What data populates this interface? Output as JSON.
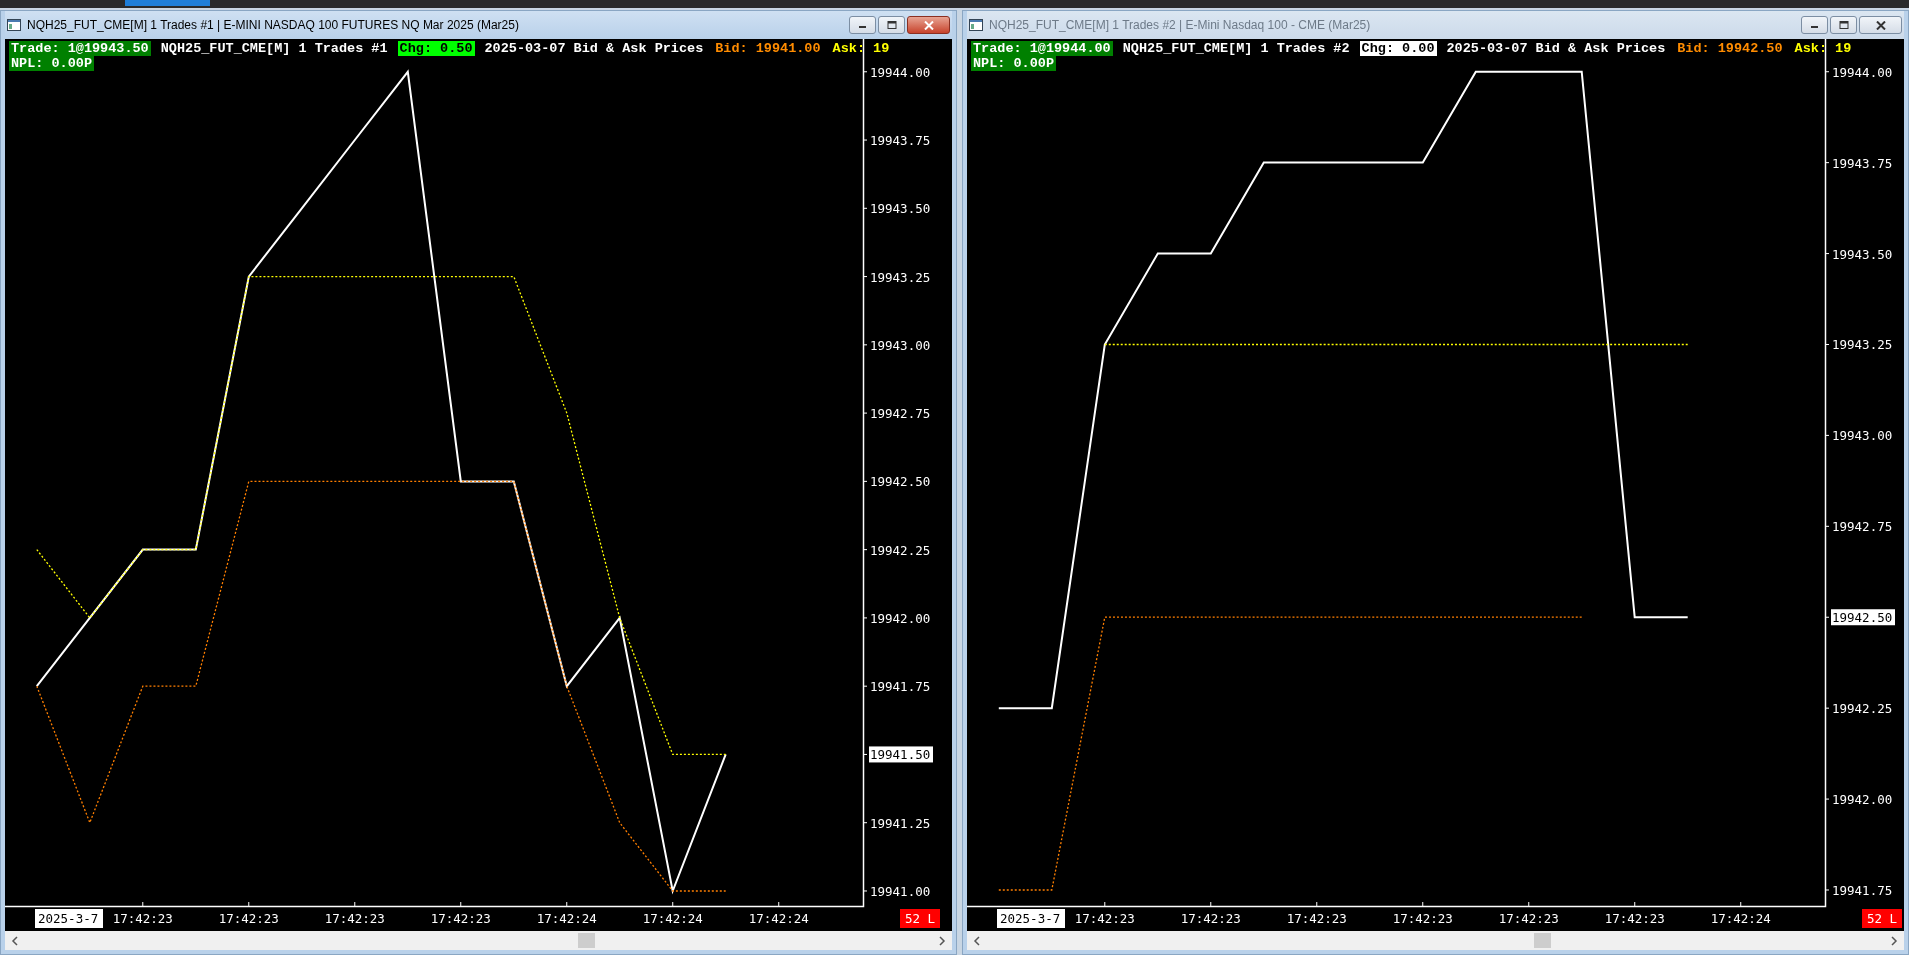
{
  "windows": [
    {
      "title": "NQH25_FUT_CME[M]  1 Trades #1 | E-MINI NASDAQ 100 FUTURES NQ Mar 2025 (Mar25)",
      "active": true,
      "header": {
        "trade": "Trade: 1@19943.50",
        "symbol": "NQH25_FUT_CME[M]  1 Trades #1",
        "chg": {
          "text": "Chg: 0.50",
          "color": "#00ff00"
        },
        "caption": "2025-03-07 Bid & Ask Prices",
        "bid": "Bid: 19941.00",
        "ask": "Ask: 19",
        "npl": "NPL: 0.00P"
      },
      "chart_data": {
        "type": "line",
        "categories": [
          null,
          null,
          "17:42:23",
          null,
          "17:42:23",
          null,
          "17:42:23",
          null,
          "17:42:23",
          null,
          "17:42:24",
          null,
          "17:42:24",
          null,
          "17:42:24"
        ],
        "ylim": [
          19940.945,
          19944.12
        ],
        "series": [
          {
            "color": "#ffff00",
            "line_style": "dashed",
            "values": [
              19942.25,
              19942.0,
              19942.25,
              19942.25,
              19943.25,
              19943.25,
              19943.25,
              19943.25,
              19943.25,
              19943.25,
              19942.75,
              19942.0,
              19941.5,
              19941.5,
              null
            ]
          },
          {
            "color": "#ff7f00",
            "line_style": "dashed",
            "values": [
              19941.75,
              19941.25,
              19941.75,
              19941.75,
              19942.5,
              19942.5,
              19942.5,
              19942.5,
              19942.5,
              19942.5,
              19941.75,
              19941.25,
              19941.0,
              19941.0,
              null
            ]
          },
          {
            "color": "#ffffff",
            "line_style": "solid",
            "values": [
              19941.75,
              19942.0,
              19942.25,
              19942.25,
              19943.25,
              19943.5,
              19943.75,
              19944.0,
              19942.5,
              19942.5,
              19941.75,
              19942.0,
              19941.0,
              19941.5,
              null
            ]
          }
        ],
        "yticks": [
          {
            "value": 19941.0,
            "label": "19941.00"
          },
          {
            "value": 19941.25,
            "label": "19941.25"
          },
          {
            "value": 19941.5,
            "label": "19941.50"
          },
          {
            "value": 19941.75,
            "label": "19941.75"
          },
          {
            "value": 19942.0,
            "label": "19942.00"
          },
          {
            "value": 19942.25,
            "label": "19942.25"
          },
          {
            "value": 19942.5,
            "label": "19942.50"
          },
          {
            "value": 19942.75,
            "label": "19942.75"
          },
          {
            "value": 19943.0,
            "label": "19943.00"
          },
          {
            "value": 19943.25,
            "label": "19943.25"
          },
          {
            "value": 19943.5,
            "label": "19943.50"
          },
          {
            "value": 19943.75,
            "label": "19943.75"
          },
          {
            "value": 19944.0,
            "label": "19944.00"
          }
        ]
      },
      "date_label": "2025-3-7",
      "status_badge": "52 L"
    },
    {
      "title": "NQH25_FUT_CME[M]  1 Trades #2 | E-Mini Nasdaq 100 - CME (Mar25)",
      "active": false,
      "header": {
        "trade": "Trade: 1@19944.00",
        "symbol": "NQH25_FUT_CME[M]  1 Trades #2",
        "chg": {
          "text": "Chg: 0.00",
          "color": "#ffffff"
        },
        "caption": "2025-03-07 Bid & Ask Prices",
        "bid": "Bid: 19942.50",
        "ask": "Ask: 19",
        "npl": "NPL: 0.00P"
      },
      "chart_data": {
        "type": "line",
        "categories": [
          null,
          null,
          "17:42:23",
          null,
          "17:42:23",
          null,
          "17:42:23",
          null,
          "17:42:23",
          null,
          "17:42:23",
          null,
          "17:42:23",
          null,
          "17:42:24"
        ],
        "ylim": [
          19941.706,
          19944.09
        ],
        "series": [
          {
            "color": "#ffff00",
            "line_style": "dashed",
            "values": [
              null,
              null,
              19943.25,
              19943.25,
              19943.25,
              19943.25,
              19943.25,
              19943.25,
              19943.25,
              19943.25,
              19943.25,
              19943.25,
              19943.25,
              19943.25,
              null
            ]
          },
          {
            "color": "#ff7f00",
            "line_style": "dashed",
            "values": [
              19941.75,
              19941.75,
              19942.5,
              19942.5,
              19942.5,
              19942.5,
              19942.5,
              19942.5,
              19942.5,
              19942.5,
              19942.5,
              19942.5,
              null,
              null,
              null
            ]
          },
          {
            "color": "#ffffff",
            "line_style": "solid",
            "values": [
              19942.25,
              19942.25,
              19943.25,
              19943.5,
              19943.5,
              19943.75,
              19943.75,
              19943.75,
              19943.75,
              19944.0,
              19944.0,
              19944.0,
              19942.5,
              19942.5,
              null
            ]
          }
        ],
        "yticks": [
          {
            "value": 19941.75,
            "label": "19941.75"
          },
          {
            "value": 19942.0,
            "label": "19942.00"
          },
          {
            "value": 19942.25,
            "label": "19942.25"
          },
          {
            "value": 19942.5,
            "label": "19942.50"
          },
          {
            "value": 19942.75,
            "label": "19942.75"
          },
          {
            "value": 19943.0,
            "label": "19943.00"
          },
          {
            "value": 19943.25,
            "label": "19943.25"
          },
          {
            "value": 19943.5,
            "label": "19943.50"
          },
          {
            "value": 19943.75,
            "label": "19943.75"
          },
          {
            "value": 19944.0,
            "label": "19944.00"
          }
        ]
      },
      "date_label": "2025-3-7",
      "status_badge": "52 L"
    }
  ]
}
